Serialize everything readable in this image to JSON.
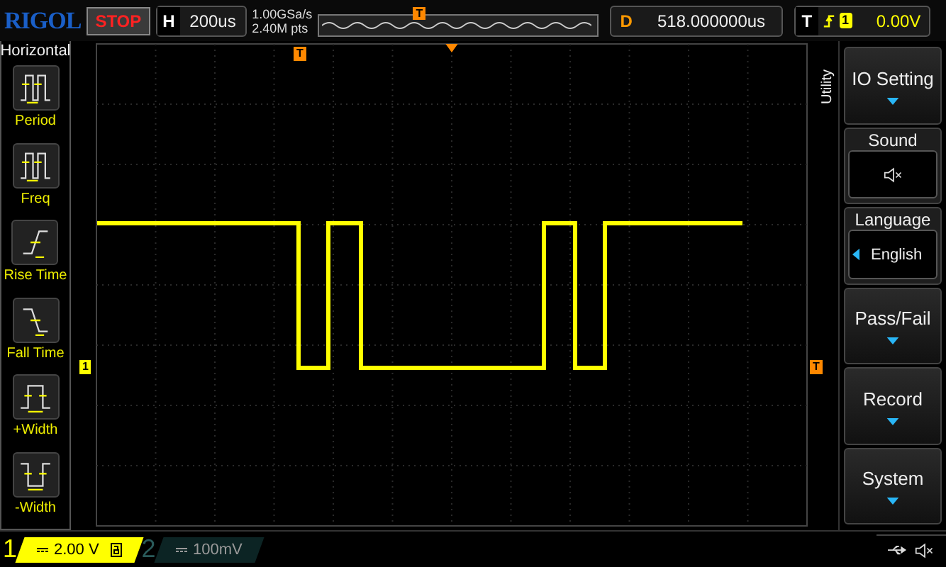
{
  "brand": "RIGOL",
  "run_state": "STOP",
  "timebase": {
    "label": "H",
    "value": "200us"
  },
  "sample_rate": "1.00GSa/s",
  "memory_depth": "2.40M pts",
  "overview_marker": "T",
  "delay": {
    "label": "D",
    "value": "518.000000us"
  },
  "trigger": {
    "label": "T",
    "channel": "1",
    "level": "0.00V"
  },
  "left_menu": {
    "title": "Horizontal",
    "items": [
      {
        "label": "Period",
        "kind": "period"
      },
      {
        "label": "Freq",
        "kind": "freq"
      },
      {
        "label": "Rise Time",
        "kind": "rise"
      },
      {
        "label": "Fall Time",
        "kind": "fall"
      },
      {
        "label": "+Width",
        "kind": "pwidth"
      },
      {
        "label": "-Width",
        "kind": "nwidth"
      }
    ]
  },
  "screen": {
    "trigger_position_marker": "T",
    "channel_marker": "1",
    "trigger_level_marker": "T"
  },
  "right_menu": {
    "title": "Utility",
    "items": [
      {
        "kind": "submenu",
        "label": "IO Setting"
      },
      {
        "kind": "sound",
        "label": "Sound",
        "on": false
      },
      {
        "kind": "select",
        "label": "Language",
        "value": "English"
      },
      {
        "kind": "submenu",
        "label": "Pass/Fail"
      },
      {
        "kind": "submenu",
        "label": "Record"
      },
      {
        "kind": "submenu",
        "label": "System"
      }
    ]
  },
  "channels": [
    {
      "number": "1",
      "scale": "2.00 V",
      "on": true
    },
    {
      "number": "2",
      "scale": "100mV",
      "on": false
    }
  ]
}
